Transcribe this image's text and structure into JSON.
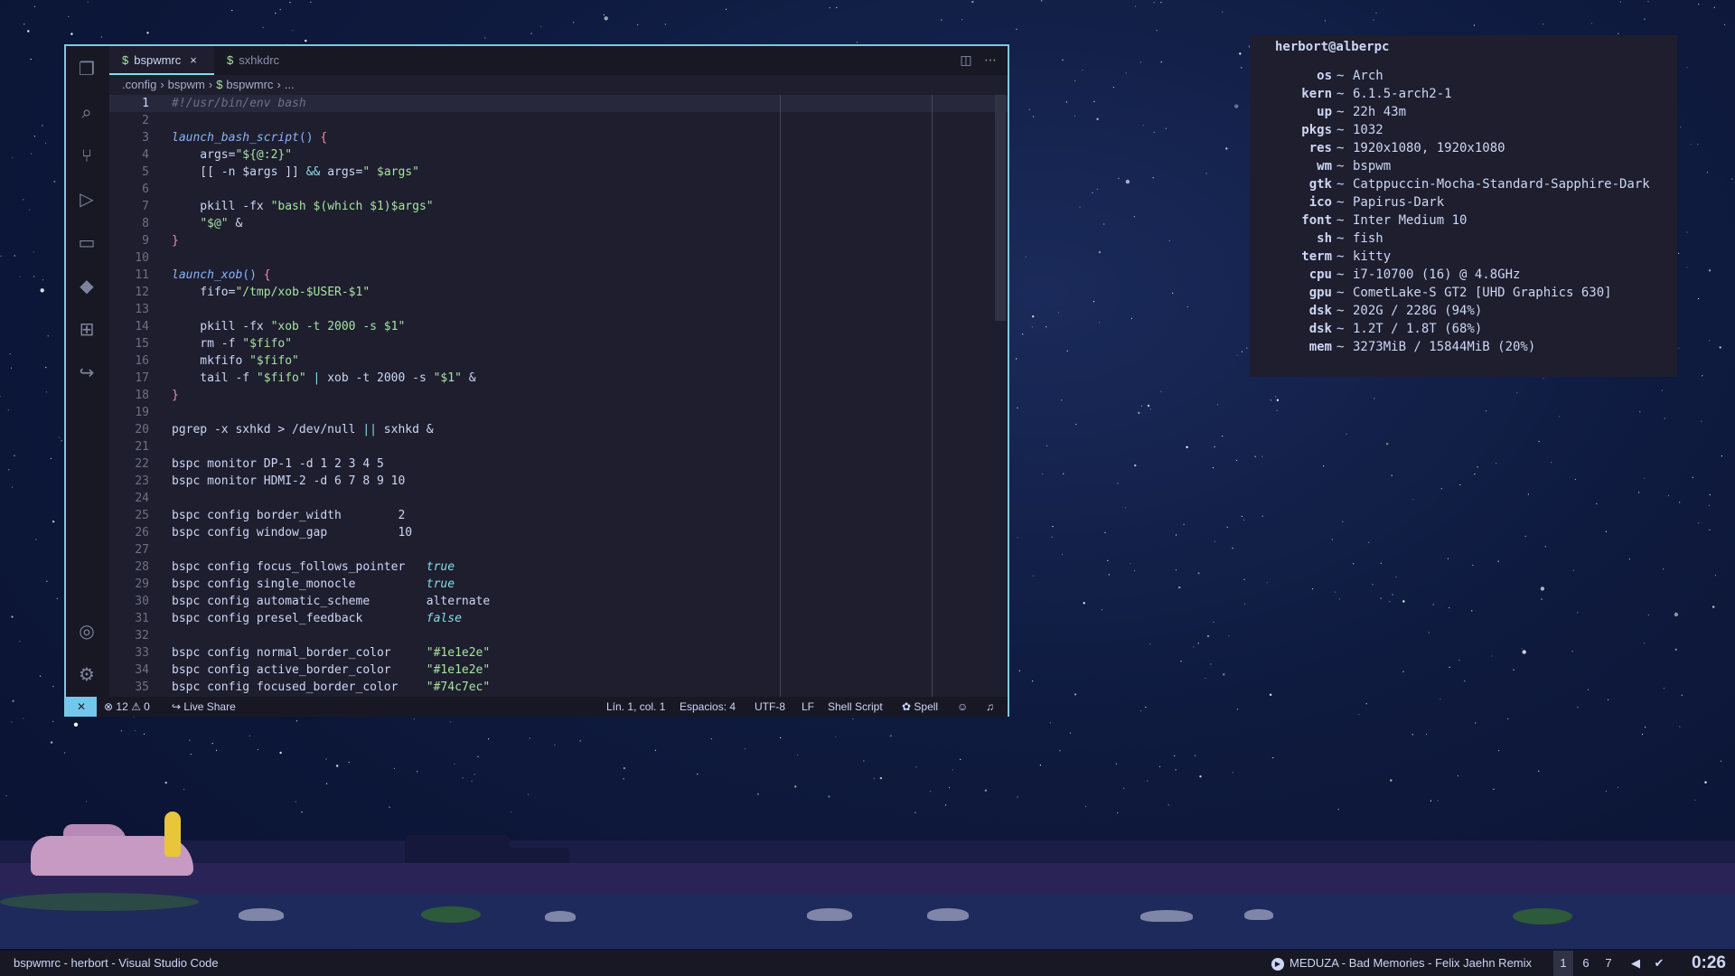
{
  "vscode": {
    "tabs": [
      {
        "label": "bspwmrc",
        "active": true,
        "close": "×"
      },
      {
        "label": "sxhkdrc",
        "active": false
      }
    ],
    "tab_dollar": "$",
    "breadcrumb": [
      ".config",
      "›",
      "bspwm",
      "›",
      "$",
      "bspwmrc",
      "›",
      "..."
    ],
    "activity_icons": [
      "files-icon",
      "search-icon",
      "source-control-icon",
      "run-debug-icon",
      "remote-explorer-icon",
      "terraform-icon",
      "extensions-icon",
      "live-share-icon"
    ],
    "activity_bottom_icons": [
      "account-icon",
      "settings-gear-icon"
    ],
    "code_lines": [
      {
        "n": "1",
        "t": "#!/usr/bin/env bash",
        "k": "cmt"
      },
      {
        "n": "2",
        "t": ""
      },
      {
        "n": "3",
        "t": "launch_bash_script() {",
        "k": "fn"
      },
      {
        "n": "4",
        "t": "    args=\"${@:2}\""
      },
      {
        "n": "5",
        "t": "    [[ -n $args ]] && args=\" $args\""
      },
      {
        "n": "6",
        "t": ""
      },
      {
        "n": "7",
        "t": "    pkill -fx \"bash $(which $1)$args\""
      },
      {
        "n": "8",
        "t": "    \"$@\" &"
      },
      {
        "n": "9",
        "t": "}",
        "k": "br"
      },
      {
        "n": "10",
        "t": ""
      },
      {
        "n": "11",
        "t": "launch_xob() {",
        "k": "fn"
      },
      {
        "n": "12",
        "t": "    fifo=\"/tmp/xob-$USER-$1\""
      },
      {
        "n": "13",
        "t": ""
      },
      {
        "n": "14",
        "t": "    pkill -fx \"xob -t 2000 -s $1\""
      },
      {
        "n": "15",
        "t": "    rm -f \"$fifo\""
      },
      {
        "n": "16",
        "t": "    mkfifo \"$fifo\""
      },
      {
        "n": "17",
        "t": "    tail -f \"$fifo\" | xob -t 2000 -s \"$1\" &"
      },
      {
        "n": "18",
        "t": "}",
        "k": "br"
      },
      {
        "n": "19",
        "t": ""
      },
      {
        "n": "20",
        "t": "pgrep -x sxhkd > /dev/null || sxhkd &"
      },
      {
        "n": "21",
        "t": ""
      },
      {
        "n": "22",
        "t": "bspc monitor DP-1 -d 1 2 3 4 5"
      },
      {
        "n": "23",
        "t": "bspc monitor HDMI-2 -d 6 7 8 9 10"
      },
      {
        "n": "24",
        "t": ""
      },
      {
        "n": "25",
        "t": "bspc config border_width        2"
      },
      {
        "n": "26",
        "t": "bspc config window_gap          10"
      },
      {
        "n": "27",
        "t": ""
      },
      {
        "n": "28",
        "t": "bspc config focus_follows_pointer   true"
      },
      {
        "n": "29",
        "t": "bspc config single_monocle          true"
      },
      {
        "n": "30",
        "t": "bspc config automatic_scheme        alternate"
      },
      {
        "n": "31",
        "t": "bspc config presel_feedback         false"
      },
      {
        "n": "32",
        "t": ""
      },
      {
        "n": "33",
        "t": "bspc config normal_border_color     \"#1e1e2e\""
      },
      {
        "n": "34",
        "t": "bspc config active_border_color     \"#1e1e2e\""
      },
      {
        "n": "35",
        "t": "bspc config focused_border_color    \"#74c7ec\""
      }
    ],
    "status": {
      "remote": "✕",
      "problems": "⊗ 12 ⚠ 0",
      "live_share": "Live Share",
      "cursor": "Lín. 1, col. 1",
      "spaces": "Espacios: 4",
      "encoding": "UTF-8",
      "eol": "LF",
      "language": "Shell Script",
      "spell": "Spell"
    },
    "colors": {
      "accent": "#74c7ec",
      "bg": "#1e1e2e"
    }
  },
  "fetch": {
    "user": "herbort@alberpc",
    "rows": [
      {
        "k": "os",
        "v": "Arch"
      },
      {
        "k": "kern",
        "v": "6.1.5-arch2-1"
      },
      {
        "k": "up",
        "v": "22h 43m"
      },
      {
        "k": "pkgs",
        "v": "1032"
      },
      {
        "k": "res",
        "v": "1920x1080, 1920x1080"
      },
      {
        "k": "wm",
        "v": "bspwm"
      },
      {
        "k": "gtk",
        "v": "Catppuccin-Mocha-Standard-Sapphire-Dark"
      },
      {
        "k": "ico",
        "v": "Papirus-Dark"
      },
      {
        "k": "font",
        "v": "Inter Medium 10"
      },
      {
        "k": "sh",
        "v": "fish"
      },
      {
        "k": "term",
        "v": "kitty"
      },
      {
        "k": "cpu",
        "v": "i7-10700 (16) @ 4.8GHz"
      },
      {
        "k": "gpu",
        "v": "CometLake-S GT2 [UHD Graphics 630]"
      },
      {
        "k": "dsk",
        "v": "202G / 228G (94%)"
      },
      {
        "k": "dsk",
        "v": "1.2T / 1.8T (68%)"
      },
      {
        "k": "mem",
        "v": "3273MiB / 15844MiB (20%)"
      }
    ],
    "separator": "~"
  },
  "taskbar": {
    "window_title": "bspwmrc - herbort - Visual Studio Code",
    "music": "MEDUZA - Bad Memories - Felix Jaehn Remix",
    "workspaces": [
      "1",
      "6",
      "7"
    ],
    "clock": "0:26"
  }
}
